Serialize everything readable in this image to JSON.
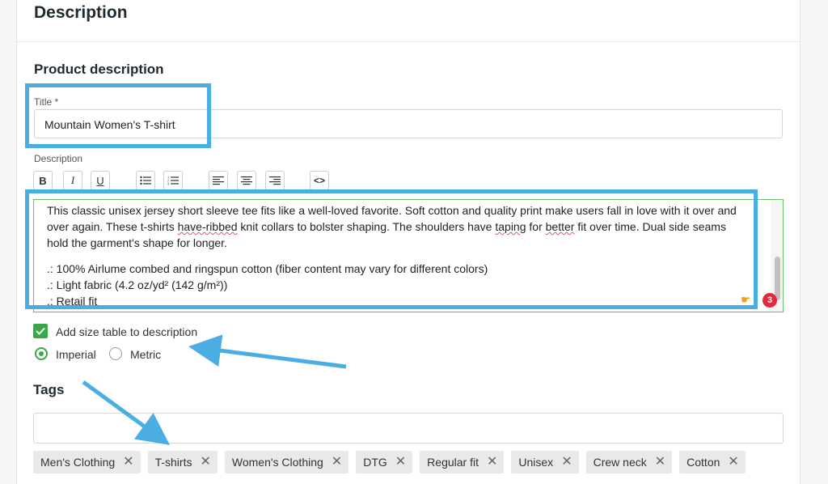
{
  "section": {
    "title": "Description"
  },
  "product_description": {
    "heading": "Product description"
  },
  "title_field": {
    "label": "Title *",
    "value": "Mountain Women's T-shirt"
  },
  "description_field": {
    "label": "Description",
    "toolbar": {
      "bold": "B",
      "italic": "I",
      "underline": "U",
      "bullet_list": "bullet-list-icon",
      "numbered_list": "numbered-list-icon",
      "align_left": "align-left-icon",
      "align_center": "align-center-icon",
      "align_right": "align-right-icon",
      "code": "<>"
    },
    "para1_a": "This classic unisex jersey short sleeve tee fits like a well-loved favorite. Soft cotton and quality print make users fall in love with it over and",
    "para1_b1": "over again. These t-shirts ",
    "para1_b_sq1": "have-ribbed",
    "para1_b2": " knit collars to bolster shaping. The shoulders have ",
    "para1_b_sq2": "taping",
    "para1_b3": " for ",
    "para1_b_sq3": "better",
    "para1_b4": " fit over time. Dual side seams",
    "para1_c": "hold the garment's shape for longer.",
    "bullets": [
      ".: 100% Airlume combed and ringspun cotton (fiber content may vary for different colors)",
      ".: Light fabric (4.2 oz/yd² (142 g/m²))",
      ".: Retail fit"
    ],
    "issues_count": "3"
  },
  "size_table": {
    "label": "Add size table to description",
    "checked": true
  },
  "units": {
    "imperial": "Imperial",
    "metric": "Metric",
    "selected": "imperial"
  },
  "tags": {
    "heading": "Tags",
    "items": [
      "Men's Clothing",
      "T-shirts",
      "Women's Clothing",
      "DTG",
      "Regular fit",
      "Unisex",
      "Crew neck",
      "Cotton"
    ]
  },
  "colors": {
    "accent_green": "#3aa64a",
    "annotation_blue": "#4aaee3",
    "badge_red": "#e02b3d"
  }
}
